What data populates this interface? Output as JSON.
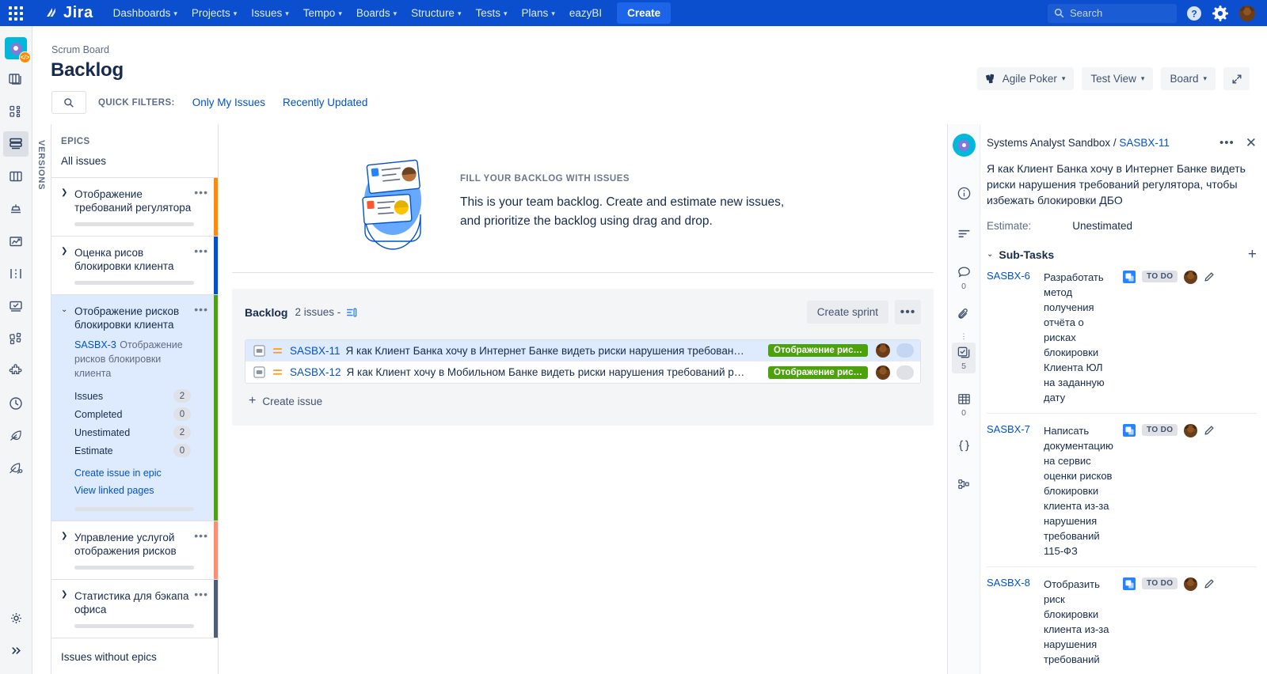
{
  "topnav": {
    "brand": "Jira",
    "items": [
      {
        "label": "Dashboards",
        "caret": "▾"
      },
      {
        "label": "Projects",
        "caret": "▾"
      },
      {
        "label": "Issues",
        "caret": "▾"
      },
      {
        "label": "Tempo",
        "caret": "▾"
      },
      {
        "label": "Boards",
        "caret": "▾"
      },
      {
        "label": "Structure",
        "caret": "▾"
      },
      {
        "label": "Tests",
        "caret": "▾"
      },
      {
        "label": "Plans",
        "caret": "▾"
      },
      {
        "label": "eazyBI",
        "caret": ""
      }
    ],
    "create_label": "Create",
    "search_placeholder": "Search",
    "icons": [
      "app-switcher-icon",
      "search-icon",
      "help-icon",
      "settings-icon",
      "user-avatar"
    ]
  },
  "leftrail": {
    "project_badge": "</>",
    "icons": [
      "project-avatar",
      "boards-icon",
      "portfolio-icon",
      "backlog-icon",
      "columns-icon",
      "releases-icon",
      "reports-icon",
      "timeline-icon",
      "tests-icon",
      "structure-icon",
      "puzzle-icon",
      "clock-icon",
      "feather-icon",
      "feather-key-icon"
    ],
    "bottom_icons": [
      "settings-gear-icon",
      "expand-chevrons-icon"
    ]
  },
  "header": {
    "breadcrumb": "Scrum Board",
    "title": "Backlog",
    "quick_filters_label": "QUICK FILTERS:",
    "filters": [
      {
        "label": "Only My Issues"
      },
      {
        "label": "Recently Updated"
      }
    ],
    "actions": [
      {
        "label": "Agile Poker",
        "caret": "▾",
        "icon": "agile-poker-icon"
      },
      {
        "label": "Test View",
        "caret": "▾",
        "icon": ""
      },
      {
        "label": "Board",
        "caret": "▾",
        "icon": ""
      }
    ],
    "fullscreen_icon": "expand-icon"
  },
  "versions_tab": {
    "label": "VERSIONS"
  },
  "epics_panel": {
    "heading": "EPICS",
    "all_issues": "All issues",
    "epics": [
      {
        "name": "Отображение требований регулятора",
        "color": "#FF8B00",
        "expanded": false,
        "twisty": "❯"
      },
      {
        "name": "Оценка рисов блокировки клиента",
        "color": "#0052CC",
        "expanded": false,
        "twisty": "❯"
      },
      {
        "name": "Отображение рисков блокировки клиента",
        "color": "#4CA20B",
        "expanded": true,
        "twisty": "⌄",
        "issue_key": "SASBX-3",
        "issue_desc": "Отображение рисков блокировки клиента",
        "stats": [
          {
            "label": "Issues",
            "value": "2"
          },
          {
            "label": "Completed",
            "value": "0"
          },
          {
            "label": "Unestimated",
            "value": "2"
          },
          {
            "label": "Estimate",
            "value": "0"
          }
        ],
        "links": [
          "Create issue in epic",
          "View linked pages"
        ]
      },
      {
        "name": "Управление услугой отображения рисков",
        "color": "#FF8F73",
        "expanded": false,
        "twisty": "❯"
      },
      {
        "name": "Статистика для бэкапа офиса",
        "color": "#505F79",
        "expanded": false,
        "twisty": "❯"
      }
    ],
    "issues_without_epics": "Issues without epics"
  },
  "main": {
    "hero": {
      "kicker": "FILL YOUR BACKLOG WITH ISSUES",
      "line1": "This is your team backlog. Create and estimate new issues,",
      "line2": "and prioritize the backlog using drag and drop."
    },
    "backlog": {
      "title": "Backlog",
      "count": "2 issues -",
      "estimate_icon": "estimate-icon",
      "create_sprint": "Create sprint",
      "more_label": "•••"
    },
    "issues": [
      {
        "type_icon": "story-icon",
        "priority_icon": "medium-priority-icon",
        "key": "SASBX-11",
        "summary": "Я как Клиент Банка хочу в Интернет Банке видеть риски нарушения требован…",
        "epic_label": "Отображение рис…",
        "epic_color": "#4CA20B",
        "selected": true
      },
      {
        "type_icon": "story-icon",
        "priority_icon": "medium-priority-icon",
        "key": "SASBX-12",
        "summary": "Я как Клиент хочу в Мобильном Банке видеть риски нарушения требований р…",
        "epic_label": "Отображение рис…",
        "epic_color": "#4CA20B",
        "selected": false
      }
    ],
    "create_issue": "Create issue"
  },
  "detail": {
    "rail": [
      {
        "icon": "info-icon",
        "count": ""
      },
      {
        "icon": "description-icon",
        "count": ""
      },
      {
        "icon": "comments-icon",
        "count": "0"
      },
      {
        "icon": "attachments-icon",
        "count": ""
      },
      {
        "icon": "subtasks-icon",
        "count": "5",
        "selected": true
      },
      {
        "icon": "table-icon",
        "count": "0"
      },
      {
        "icon": "code-icon",
        "count": ""
      },
      {
        "icon": "dev-icon",
        "count": ""
      }
    ],
    "project_name": "Systems Analyst Sandbox",
    "separator": "/",
    "issue_key": "SASBX-11",
    "more_label": "•••",
    "close_label": "✕",
    "summary": "Я как Клиент Банка хочу в Интернет Банке видеть риски нарушения требований регулятора, чтобы избежать блокировки ДБО",
    "estimate_label": "Estimate:",
    "estimate_value": "Unestimated",
    "subtasks_title": "Sub-Tasks",
    "subtasks_twisty": "⌄",
    "add_label": "+",
    "subtasks": [
      {
        "key": "SASBX-6",
        "summary": "Разработать метод получения отчёта о рисках блокировки Клиента ЮЛ на заданную дату",
        "status": "TO DO",
        "type_icon": "subtask-icon",
        "edit_icon": "pencil-icon"
      },
      {
        "key": "SASBX-7",
        "summary": "Написать документацию на сервис оценки рисков блокировки клиента из-за нарушения требований 115-ФЗ",
        "status": "TO DO",
        "type_icon": "subtask-icon",
        "edit_icon": "pencil-icon"
      },
      {
        "key": "SASBX-8",
        "summary": "Отобразить риск блокировки клиента из-за нарушения требований",
        "status": "TO DO",
        "type_icon": "subtask-icon",
        "edit_icon": "pencil-icon"
      }
    ]
  },
  "colors": {
    "nav_blue": "#0B4FCE",
    "link_blue": "#0052CC",
    "selected_row": "#DEEBFF",
    "epic_green": "#4CA20B",
    "text": "#172B4D",
    "subtle_text": "#5E6C84"
  }
}
